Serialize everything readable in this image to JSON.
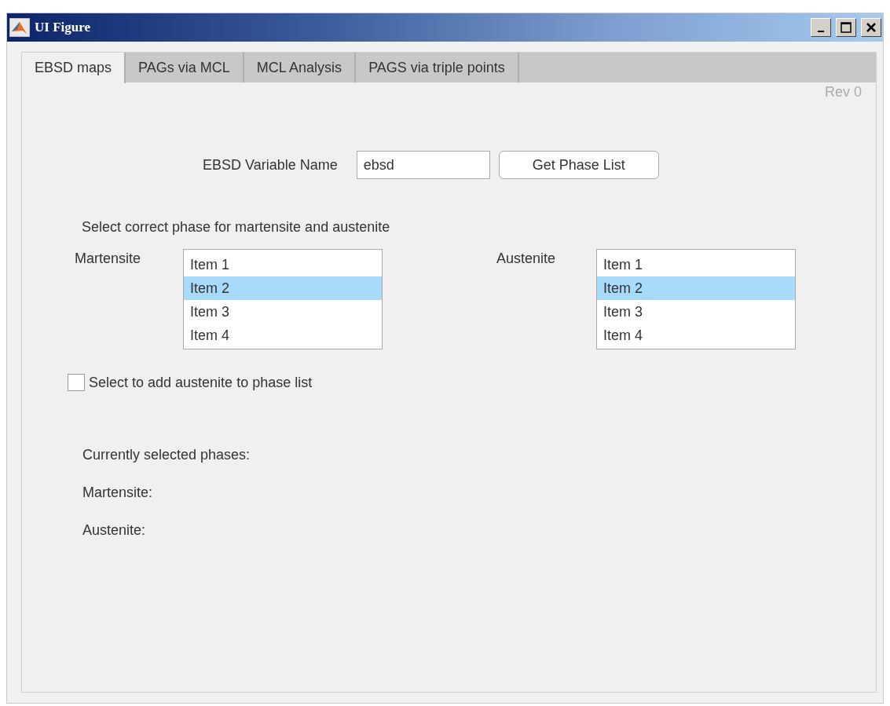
{
  "window": {
    "title": "UI Figure"
  },
  "tabs": [
    {
      "label": "EBSD maps",
      "selected": true
    },
    {
      "label": "PAGs via MCL",
      "selected": false
    },
    {
      "label": "MCL Analysis",
      "selected": false
    },
    {
      "label": "PAGS via triple points",
      "selected": false
    }
  ],
  "revision": "Rev 0",
  "variable": {
    "label": "EBSD Variable Name",
    "value": "ebsd",
    "button": "Get Phase List"
  },
  "phase_prompt": "Select correct phase for martensite and austenite",
  "lists": [
    {
      "label": "Martensite",
      "items": [
        {
          "text": "Item 1",
          "selected": false
        },
        {
          "text": "Item 2",
          "selected": true
        },
        {
          "text": "Item 3",
          "selected": false
        },
        {
          "text": "Item 4",
          "selected": false
        }
      ]
    },
    {
      "label": "Austenite",
      "items": [
        {
          "text": "Item 1",
          "selected": false
        },
        {
          "text": "Item 2",
          "selected": true
        },
        {
          "text": "Item 3",
          "selected": false
        },
        {
          "text": "Item 4",
          "selected": false
        }
      ]
    }
  ],
  "add_austenite": {
    "label": "Select to add austenite to phase list",
    "checked": false
  },
  "current": {
    "heading": "Currently selected phases:",
    "rows": [
      "Martensite:",
      "Austenite:"
    ]
  }
}
